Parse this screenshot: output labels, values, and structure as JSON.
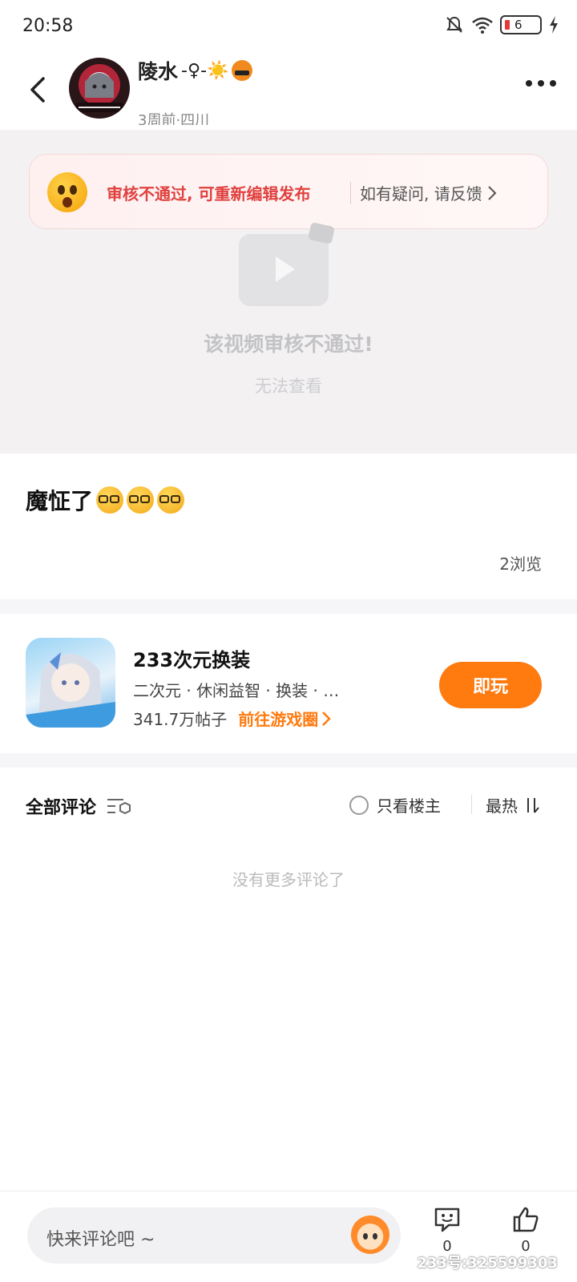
{
  "status_bar": {
    "time": "20:58",
    "battery": "6"
  },
  "header": {
    "user_name": "陵水",
    "user_name_decoration": "-♀-☀️",
    "user_meta": "3周前·四川"
  },
  "banner": {
    "message": "审核不通过, 可重新编辑发布",
    "feedback": "如有疑问, 请反馈"
  },
  "video": {
    "message": "该视频审核不通过!",
    "sub_message": "无法查看"
  },
  "post": {
    "title": "魔怔了",
    "views": "2浏览"
  },
  "game": {
    "name": "233次元换装",
    "tags": "二次元 · 休闲益智 · 换装 · …",
    "posts": "341.7万帖子",
    "link": "前往游戏圈",
    "play_button": "即玩"
  },
  "comments": {
    "title": "全部评论",
    "only_owner": "只看楼主",
    "sort": "最热",
    "empty": "没有更多评论了"
  },
  "bottom_bar": {
    "input_placeholder": "快来评论吧 ~",
    "comment_count": "0",
    "like_count": "0",
    "watermark": "233号:325599303"
  }
}
